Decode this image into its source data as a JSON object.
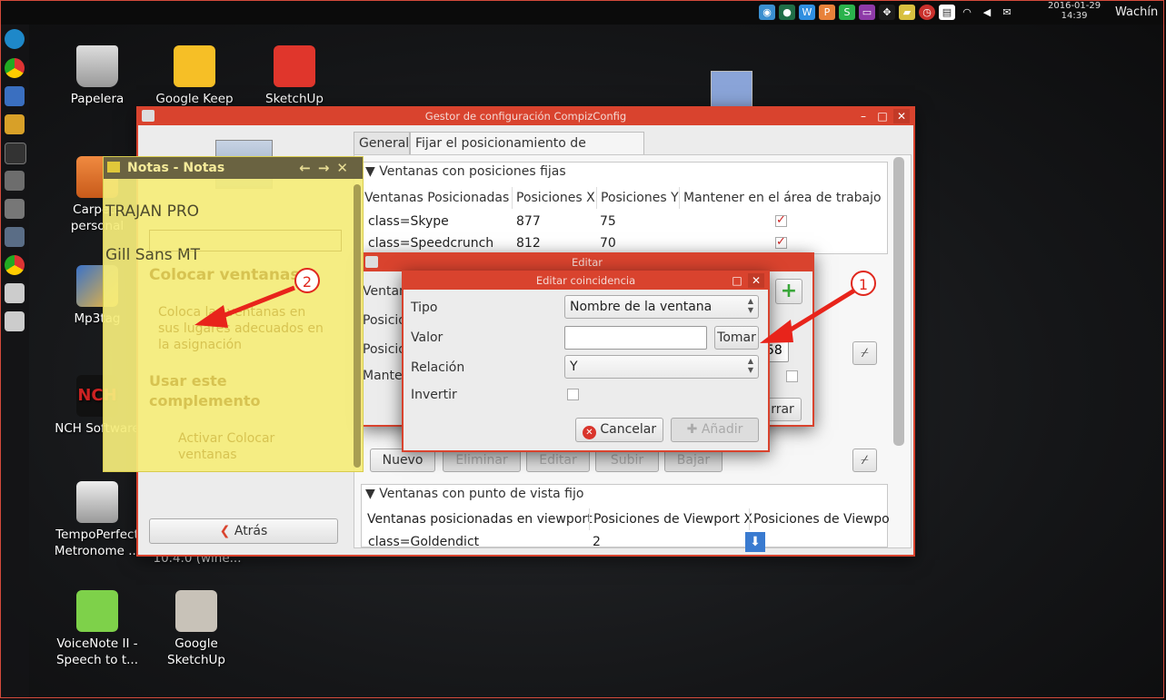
{
  "topbar": {
    "tray_icons": [
      "shutter-icon",
      "bullet-icon",
      "writer-icon",
      "presentation-icon",
      "spreadsheet-icon",
      "battery-icon",
      "dropbox-icon",
      "folder-icon",
      "alarm-icon",
      "notebook-icon",
      "wifi-icon",
      "volume-icon",
      "mail-icon"
    ],
    "date": "2016-01-29",
    "time": "14:39",
    "user": "Wachín"
  },
  "desktop": {
    "icons": [
      {
        "label": "Papelera"
      },
      {
        "label": "Google Keep"
      },
      {
        "label": "SketchUp"
      },
      {
        "label": "Carpeta personal"
      },
      {
        "label": "Mp3tag"
      },
      {
        "label": "NCH Software"
      },
      {
        "label": "TempoPerfect Metronome ..."
      },
      {
        "label": "10.4.0 (wine..."
      },
      {
        "label": "VoiceNote II - Speech to t..."
      },
      {
        "label": "Google SketchUp"
      }
    ]
  },
  "compiz": {
    "title": "Gestor de configuración CompizConfig",
    "tabs": [
      "General",
      "Fijar el posicionamiento de ventanas"
    ],
    "fixed_section": "▼ Ventanas con posiciones fijas",
    "columns": [
      "Ventanas Posicionadas",
      "Posiciones X",
      "Posiciones Y",
      "Mantener en el área de trabajo"
    ],
    "rows": [
      {
        "window": "class=Skype",
        "x": "877",
        "y": "75"
      },
      {
        "window": "class=Speedcrunch",
        "x": "812",
        "y": "70"
      }
    ],
    "buttons": [
      "Nuevo",
      "Eliminar",
      "Editar",
      "Subir",
      "Bajar"
    ],
    "viewport_section": "▼ Ventanas con punto de vista fijo",
    "viewport_columns": [
      "Ventanas posicionadas en viewport",
      "Posiciones de Viewport X",
      "Posiciones de Viewpo"
    ],
    "viewport_row": {
      "window": "class=Goldendict",
      "x": "2"
    },
    "back": "Atrás",
    "sidebar_ghost": {
      "heading": "Colocar ventanas",
      "desc": "Coloca las ventanas en sus lugares adecuados en la asignación",
      "use": "Usar este complemento",
      "activate": "Activar Colocar ventanas"
    }
  },
  "editar": {
    "title": "Editar",
    "labels": [
      "Ventan",
      "Posicio",
      "Posicio",
      "Manten"
    ],
    "spin_value": "58",
    "close_partial": "rrar"
  },
  "coincidencia": {
    "title": "Editar coincidencia",
    "tipo_label": "Tipo",
    "tipo_value": "Nombre de la ventana",
    "valor_label": "Valor",
    "valor_value": "",
    "tomar": "Tomar",
    "relacion_label": "Relación",
    "relacion_value": "Y",
    "invertir_label": "Invertir",
    "cancel": "Cancelar",
    "add": "Añadir"
  },
  "notes": {
    "title": "Notas - Notas",
    "line1": "TRAJAN PRO",
    "line2": "Gill Sans MT"
  },
  "annotations": {
    "badge1": "1",
    "badge2": "2"
  },
  "colors": {
    "accent": "#d9432e",
    "arrow": "#e8241b",
    "notes_bg": "#f5ed7b"
  }
}
